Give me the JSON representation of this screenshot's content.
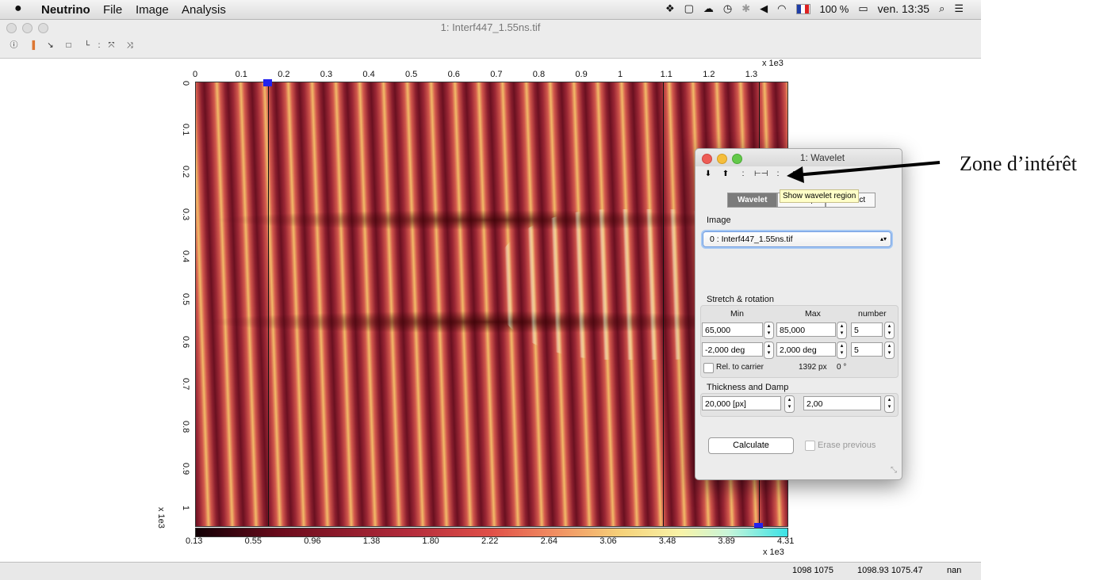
{
  "menubar": {
    "app": "Neutrino",
    "menus": [
      "File",
      "Image",
      "Analysis"
    ],
    "battery": "100 %",
    "clock": "ven. 13:35"
  },
  "window": {
    "title": "1: Interf447_1.55ns.tif",
    "toolbar_icons": [
      "info-icon",
      "colormap-icon",
      "zoom-icon",
      "rect-icon",
      "axes-icon",
      "arrows-in-icon",
      "arrows-out-icon"
    ]
  },
  "axes": {
    "x_ticks": [
      "0",
      "0.1",
      "0.2",
      "0.3",
      "0.4",
      "0.5",
      "0.6",
      "0.7",
      "0.8",
      "0.9",
      "1",
      "1.1",
      "1.2",
      "1.3"
    ],
    "x_unit": "x 1e3",
    "y_ticks": [
      "0",
      "0.1",
      "0.2",
      "0.3",
      "0.4",
      "0.5",
      "0.6",
      "0.7",
      "0.8",
      "0.9",
      "1"
    ],
    "y_unit": "x 1e3",
    "colorbar_ticks": [
      "0.13",
      "0.55",
      "0.96",
      "1.38",
      "1.80",
      "2.22",
      "2.64",
      "3.06",
      "3.48",
      "3.89",
      "4.31"
    ],
    "colorbar_unit": "x 1e3"
  },
  "status": {
    "pixel": "1098  1075",
    "coords": "1098.93  1075.47",
    "value": "nan"
  },
  "wavelet": {
    "title": "1: Wavelet",
    "tabs": [
      "Wavelet",
      "Unwrap",
      "Subtract"
    ],
    "tooltip": "Show wavelet region",
    "image_label": "Image",
    "image_value": "0 : Interf447_1.55ns.tif",
    "stretch_label": "Stretch & rotation",
    "col_min": "Min",
    "col_max": "Max",
    "col_number": "number",
    "stretch_min": "65,000",
    "stretch_max": "85,000",
    "stretch_n": "5",
    "rot_min": "-2,000 deg",
    "rot_max": "2,000 deg",
    "rot_n": "5",
    "rel_carrier": "Rel. to carrier",
    "carrier_px": "1392 px",
    "carrier_deg": "0 °",
    "thick_label": "Thickness and Damp",
    "thickness": "20,000 [px]",
    "damp": "2,00",
    "calculate": "Calculate",
    "erase": "Erase previous"
  },
  "annotation": "Zone d’intérêt"
}
